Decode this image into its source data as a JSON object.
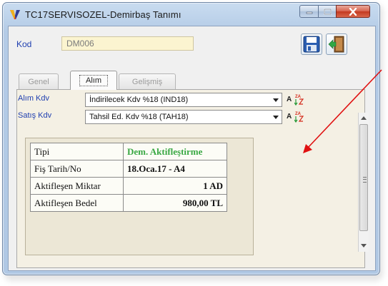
{
  "window": {
    "title": "TC17SERVISOZEL-Demirbaş Tanımı"
  },
  "kod": {
    "label": "Kod",
    "value": "DM006"
  },
  "tabs": [
    {
      "label": "Genel"
    },
    {
      "label": "Alım"
    },
    {
      "label": "Gelişmiş"
    }
  ],
  "alim_kdv": {
    "label": "Alım Kdv",
    "value": "İndirilecek Kdv %18 (IND18)"
  },
  "satis_kdv": {
    "label": "Satış Kdv",
    "value": "Tahsil Ed. Kdv %18 (TAH18)"
  },
  "a_label": "A",
  "info_rows": [
    {
      "key": "Tipi",
      "value": "Dem. Aktifleştirme"
    },
    {
      "key": "Fiş Tarih/No",
      "value": "18.Oca.17 - A4"
    },
    {
      "key": "Aktifleşen Miktar",
      "value": "1 AD"
    },
    {
      "key": "Aktifleşen Bedel",
      "value": "980,00 TL"
    }
  ],
  "colors": {
    "label_blue": "#1f3fb0",
    "type_green": "#39a843",
    "annotation_red": "#e01010"
  }
}
